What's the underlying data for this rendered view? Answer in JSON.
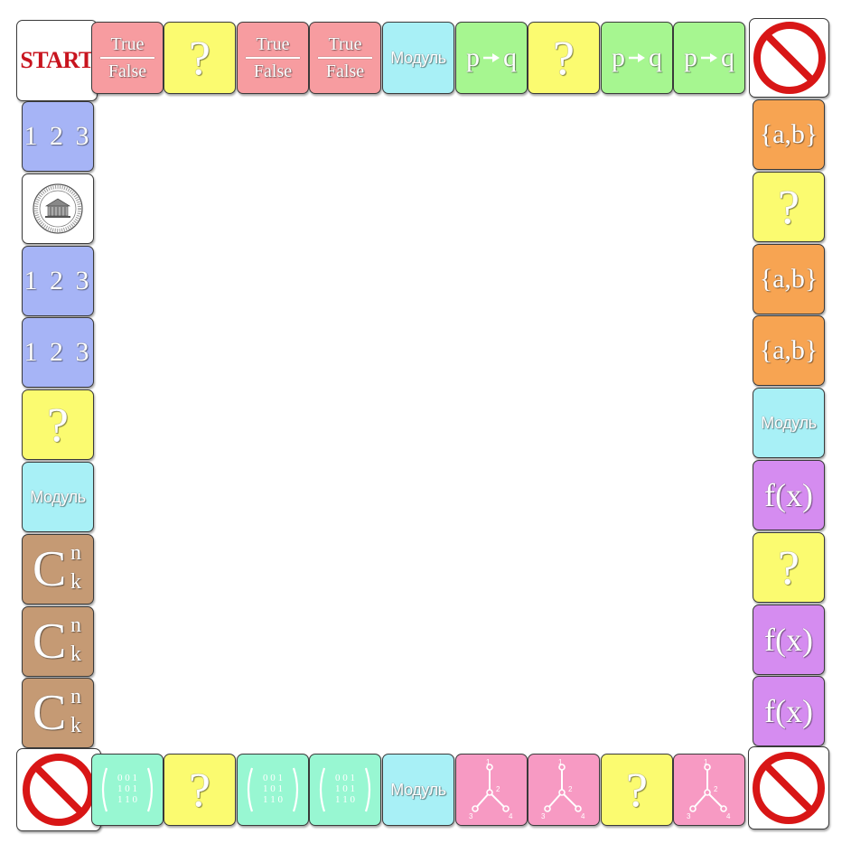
{
  "board": {
    "colors": {
      "tf": "#f79ca0",
      "question": "#fbfb70",
      "modul": "#a8f0f6",
      "logic": "#a6f690",
      "numbers": "#a6b4f6",
      "sets": "#f7a452",
      "function": "#d58cf0",
      "combinatorics": "#c59a74",
      "matrix": "#98f7d2",
      "graph": "#f79ac3",
      "corner": "#ffffff",
      "stop_red": "#d81616"
    },
    "labels": {
      "start": "START",
      "true": "True",
      "false": "False",
      "question": "?",
      "modul": "Модуль",
      "p": "p",
      "q": "q",
      "numbers": "1 2 3",
      "sets": "{a,b}",
      "function": "f(x)",
      "comb_c": "C",
      "comb_n": "n",
      "comb_k": "k",
      "matrix_rows": [
        "0 0 1",
        "1 0 1",
        "1 1 0"
      ],
      "graph_nodes": [
        "1",
        "2",
        "3",
        "4"
      ]
    },
    "top_row": [
      "start",
      "tf",
      "question",
      "tf",
      "tf",
      "modul",
      "logic",
      "question",
      "logic",
      "logic",
      "stop"
    ],
    "right_column": [
      "sets",
      "question",
      "sets",
      "sets",
      "modul",
      "function",
      "question",
      "function",
      "function"
    ],
    "bottom_row": [
      "stop",
      "matrix",
      "question",
      "matrix",
      "matrix",
      "modul",
      "graph",
      "graph",
      "question",
      "graph",
      "stop"
    ],
    "left_column": [
      "numbers",
      "emblem",
      "numbers",
      "numbers",
      "question",
      "modul",
      "combinatorics",
      "combinatorics",
      "combinatorics"
    ]
  }
}
